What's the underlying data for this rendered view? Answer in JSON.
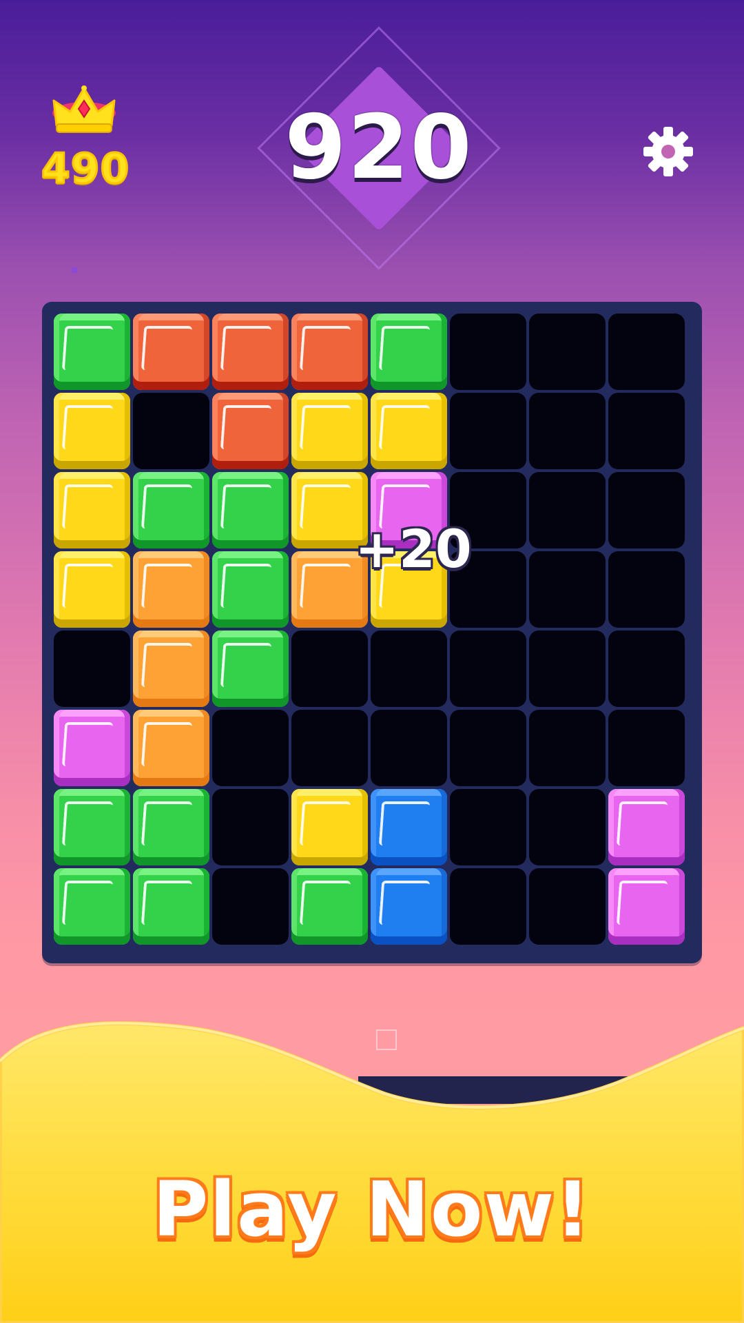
{
  "hud": {
    "best_score": "490",
    "current_score": "920",
    "best_icon": "crown-icon",
    "settings_icon": "gear-icon"
  },
  "board": {
    "rows": 8,
    "cols": 8,
    "cells": [
      [
        "green",
        "orange",
        "orange",
        "orange",
        "green",
        "empty",
        "empty",
        "empty"
      ],
      [
        "yellow",
        "empty",
        "orange",
        "yellow",
        "yellow",
        "empty",
        "empty",
        "empty"
      ],
      [
        "yellow",
        "green",
        "green",
        "yellow",
        "pink",
        "empty",
        "empty",
        "empty"
      ],
      [
        "yellow",
        "amber",
        "green",
        "amber",
        "yellow",
        "empty",
        "empty",
        "empty"
      ],
      [
        "empty",
        "amber",
        "green",
        "empty",
        "empty",
        "empty",
        "empty",
        "empty"
      ],
      [
        "pink",
        "amber",
        "empty",
        "empty",
        "empty",
        "empty",
        "empty",
        "empty"
      ],
      [
        "green",
        "green",
        "empty",
        "yellow",
        "blue",
        "empty",
        "empty",
        "pink"
      ],
      [
        "green",
        "green",
        "empty",
        "green",
        "blue",
        "empty",
        "empty",
        "pink"
      ]
    ],
    "combo_popup": "+20"
  },
  "cta": {
    "label": "Play Now!"
  },
  "colors": {
    "green": "#33d24a",
    "orange": "#f0643c",
    "yellow": "#ffd81a",
    "amber": "#ffa235",
    "pink": "#e865f0",
    "blue": "#1f7ef0",
    "empty": "#03030f",
    "board_frame": "#232b5e",
    "best_score_text": "#ffe11e",
    "cta_outline": "#ff7a1a",
    "bottom_panel": "#ffd83a"
  }
}
